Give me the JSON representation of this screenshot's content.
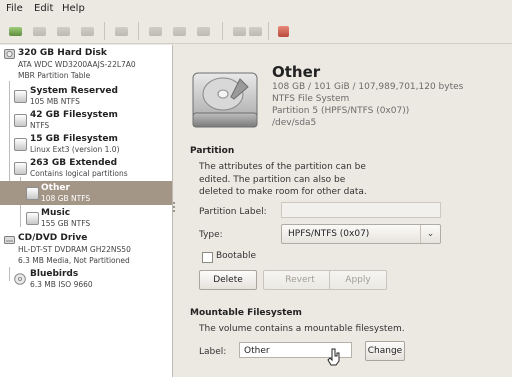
{
  "menu": {
    "file": "File",
    "edit": "Edit",
    "help": "Help"
  },
  "toolbar": {
    "buttons": [
      "new-icon",
      "eject-icon",
      "delete-icon",
      "export-icon",
      "unlock-icon",
      "import-icon",
      "save-icon",
      "unmount-icon",
      "settings-icon",
      "restore-icon",
      "check-icon"
    ]
  },
  "tree": {
    "hard_disk": {
      "title": "320 GB Hard Disk",
      "line1": "ATA WDC WD3200AAJS-22L7A0",
      "line2": "MBR Partition Table"
    },
    "items": [
      {
        "title": "System Reserved",
        "sub": "105 MB NTFS"
      },
      {
        "title": "42 GB Filesystem",
        "sub": "NTFS"
      },
      {
        "title": "15 GB Filesystem",
        "sub": "Linux Ext3 (version 1.0)"
      },
      {
        "title": "263 GB Extended",
        "sub": "Contains logical partitions"
      },
      {
        "title": "Other",
        "sub": "108 GB NTFS"
      },
      {
        "title": "Music",
        "sub": "155 GB NTFS"
      }
    ],
    "cd_drive": {
      "title": "CD/DVD Drive",
      "line1": "HL-DT-ST DVDRAM GH22NS50",
      "line2": "6.3 MB Media, Not Partitioned"
    },
    "bluebirds": {
      "title": "Bluebirds",
      "sub": "6.3 MB ISO 9660"
    }
  },
  "detail": {
    "title": "Other",
    "size": "108 GB / 101 GiB / 107,989,701,120 bytes",
    "fs": "NTFS File System",
    "partition": "Partition 5 (HPFS/NTFS (0x07))",
    "device": "/dev/sda5",
    "partition_section": "Partition",
    "partition_desc": [
      "The attributes of the partition can be",
      "edited. The partition can also be",
      "deleted to make room for other data."
    ],
    "partition_label": "Partition Label:",
    "partition_label_value": "",
    "type_label": "Type:",
    "type_value": "HPFS/NTFS (0x07)",
    "bootable_label": "Bootable",
    "delete_label": "Delete",
    "revert_label": "Revert",
    "apply_label": "Apply",
    "mount_section": "Mountable Filesystem",
    "mount_desc": "The volume contains a mountable filesystem.",
    "label_label": "Label:",
    "label_value": "Other",
    "change_label": "Change"
  }
}
